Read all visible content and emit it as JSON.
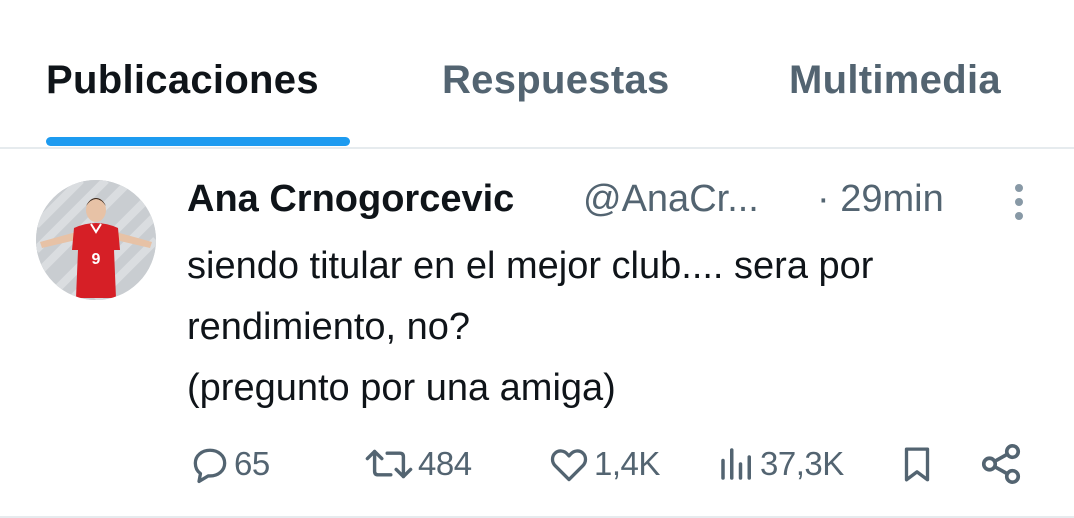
{
  "tabs": [
    {
      "label": "Publicaciones",
      "active": true
    },
    {
      "label": "Respuestas",
      "active": false
    },
    {
      "label": "Multimedia",
      "active": false
    }
  ],
  "colors": {
    "accent": "#1d9bf0",
    "text": "#0f1419",
    "secondary": "#536471",
    "divider": "#e6ebee"
  },
  "post": {
    "author": {
      "name": "Ana Crnogorcevic",
      "handle": "@AnaCr...",
      "avatar_jersey_number": "9"
    },
    "time": "· 29min",
    "text_lines": [
      "siendo titular en el mejor club.... sera por",
      "rendimiento, no?",
      "(pregunto por una amiga)"
    ],
    "actions": {
      "replies": {
        "icon": "reply-icon",
        "count": "65"
      },
      "reposts": {
        "icon": "repost-icon",
        "count": "484"
      },
      "likes": {
        "icon": "heart-icon",
        "count": "1,4K"
      },
      "views": {
        "icon": "views-icon",
        "count": "37,3K"
      },
      "bookmark": {
        "icon": "bookmark-icon"
      },
      "share": {
        "icon": "share-icon"
      }
    },
    "more_icon": "more-vertical-icon"
  }
}
